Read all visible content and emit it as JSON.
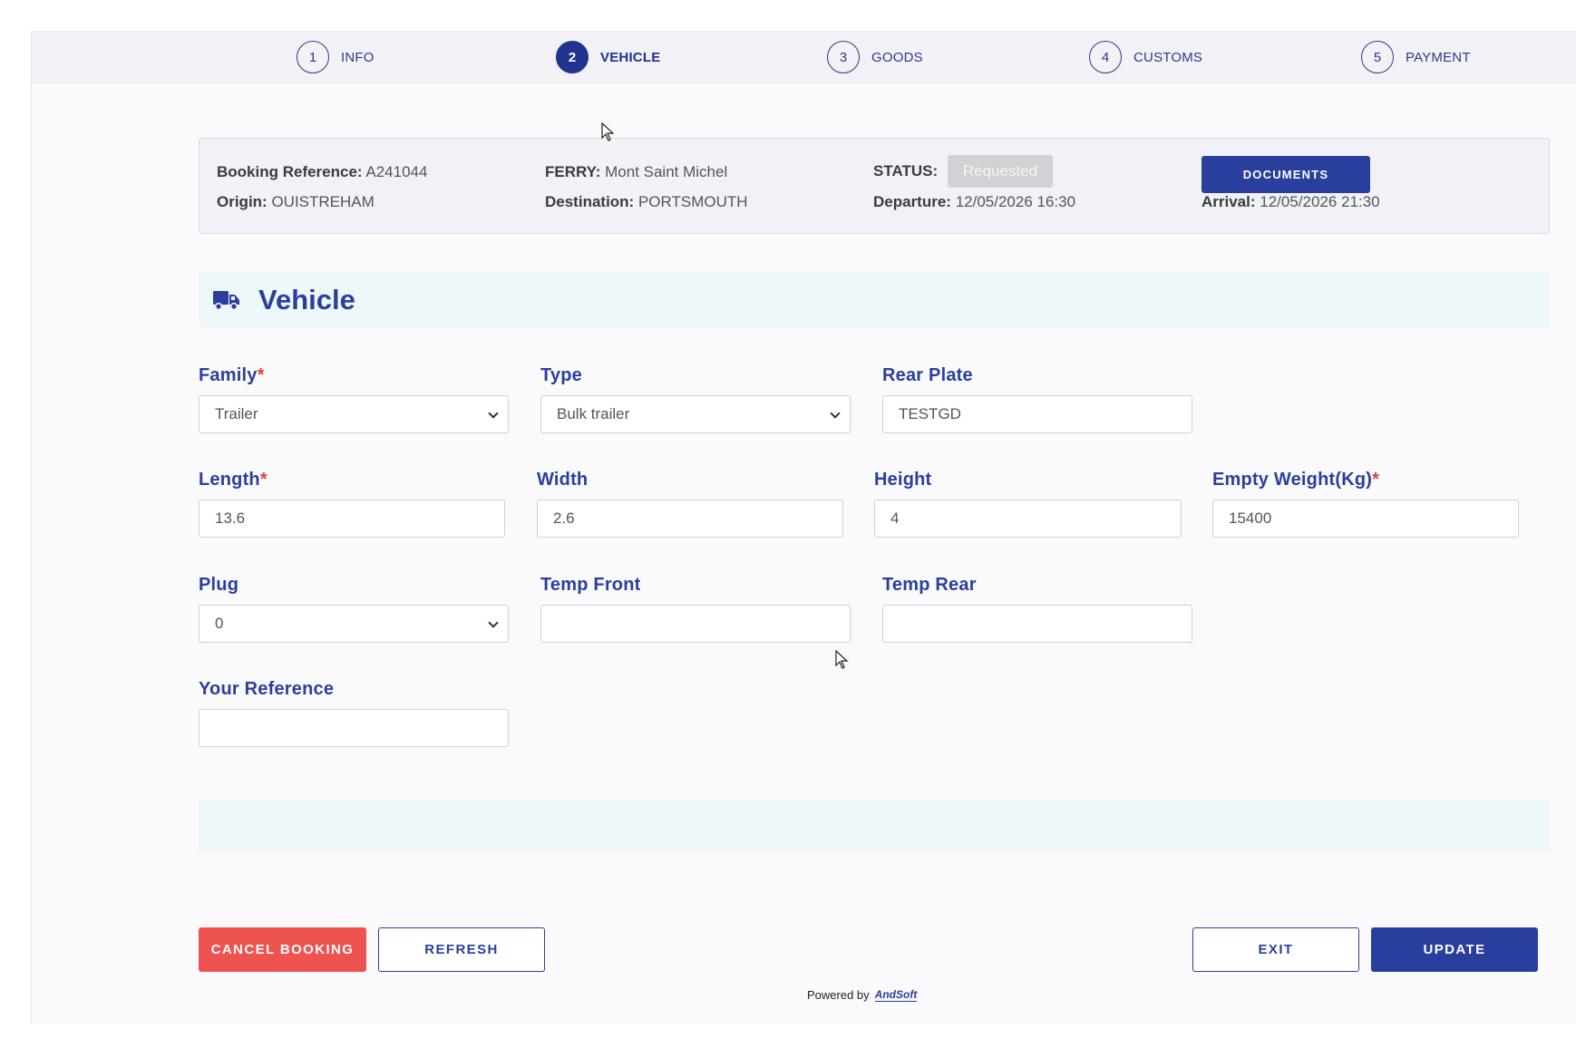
{
  "steps": [
    {
      "num": "1",
      "label": "INFO"
    },
    {
      "num": "2",
      "label": "VEHICLE"
    },
    {
      "num": "3",
      "label": "GOODS"
    },
    {
      "num": "4",
      "label": "CUSTOMS"
    },
    {
      "num": "5",
      "label": "PAYMENT"
    }
  ],
  "summary": {
    "booking_ref_label": "Booking Reference:",
    "booking_ref": "A241044",
    "origin_label": "Origin:",
    "origin": "OUISTREHAM",
    "ferry_label": "FERRY:",
    "ferry": "Mont Saint Michel",
    "destination_label": "Destination:",
    "destination": "PORTSMOUTH",
    "status_label": "STATUS:",
    "status": "Requested",
    "departure_label": "Departure:",
    "departure": "12/05/2026 16:30",
    "arrival_label": "Arrival:",
    "arrival": "12/05/2026 21:30",
    "documents_button": "DOCUMENTS"
  },
  "section": {
    "title": "Vehicle",
    "icon": "truck-icon"
  },
  "fields": {
    "family": {
      "label": "Family",
      "value": "Trailer"
    },
    "type": {
      "label": "Type",
      "value": "Bulk trailer"
    },
    "rear_plate": {
      "label": "Rear Plate",
      "value": "TESTGD"
    },
    "length": {
      "label": "Length",
      "value": "13.6"
    },
    "width": {
      "label": "Width",
      "value": "2.6"
    },
    "height": {
      "label": "Height",
      "value": "4"
    },
    "empty_weight": {
      "label": "Empty Weight(Kg)",
      "value": "15400"
    },
    "plug": {
      "label": "Plug",
      "value": "0"
    },
    "temp_front": {
      "label": "Temp Front",
      "value": ""
    },
    "temp_rear": {
      "label": "Temp Rear",
      "value": ""
    },
    "your_reference": {
      "label": "Your Reference",
      "value": ""
    },
    "required_mark": "*"
  },
  "buttons": {
    "cancel": "CANCEL BOOKING",
    "refresh": "REFRESH",
    "exit": "EXIT",
    "update": "UPDATE"
  },
  "footer": {
    "powered_by": "Powered by",
    "brand": "AndSoft"
  },
  "colors": {
    "primary": "#2a3f9d",
    "danger": "#ef5350",
    "band": "#eef8fb"
  }
}
